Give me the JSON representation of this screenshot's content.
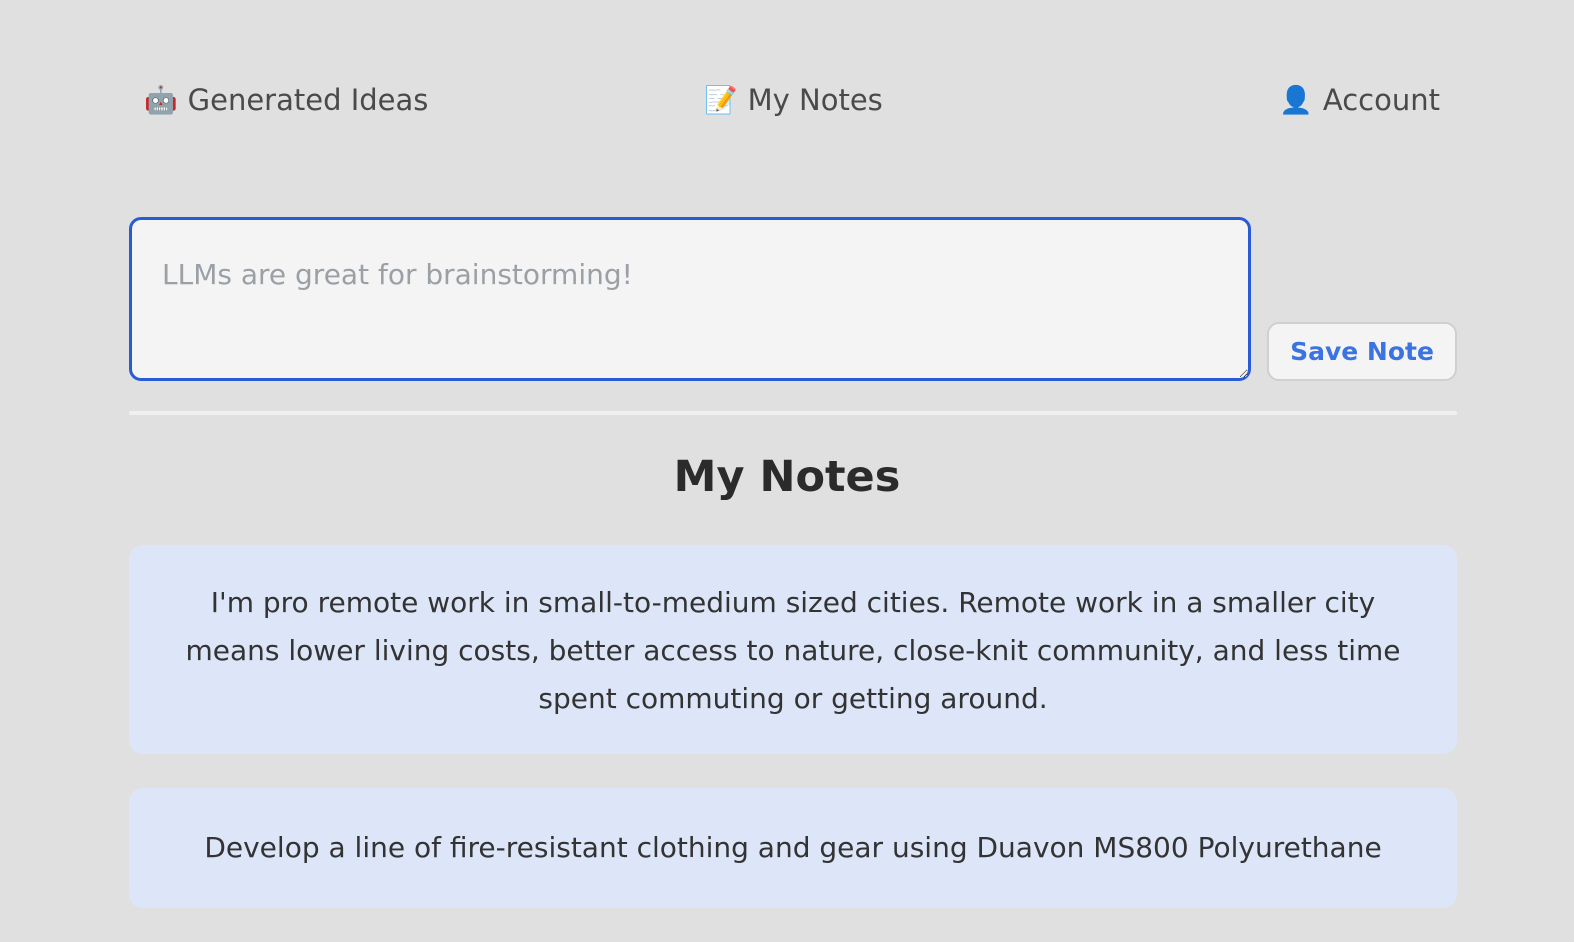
{
  "nav": {
    "generated_ideas": {
      "icon": "robot-icon",
      "glyph": "🤖",
      "label": "Generated Ideas"
    },
    "my_notes": {
      "icon": "memo-icon",
      "glyph": "📝",
      "label": "My Notes"
    },
    "account": {
      "icon": "user-icon",
      "glyph": "👤",
      "label": "Account"
    }
  },
  "editor": {
    "placeholder": "LLMs are great for brainstorming!",
    "value": "",
    "save_label": "Save Note"
  },
  "notes_section": {
    "title": "My Notes",
    "notes": [
      {
        "text": "I'm pro remote work in small-to-medium sized cities. Remote work in a smaller city means lower living costs, better access to nature, close-knit community, and less time spent commuting or getting around."
      },
      {
        "text": "Develop a line of fire-resistant clothing and gear using Duavon MS800 Polyurethane"
      }
    ]
  },
  "colors": {
    "background": "#e0e0e0",
    "accent": "#2a5bd7",
    "button_text": "#3b73e3",
    "card_background": "#dce6f8"
  }
}
